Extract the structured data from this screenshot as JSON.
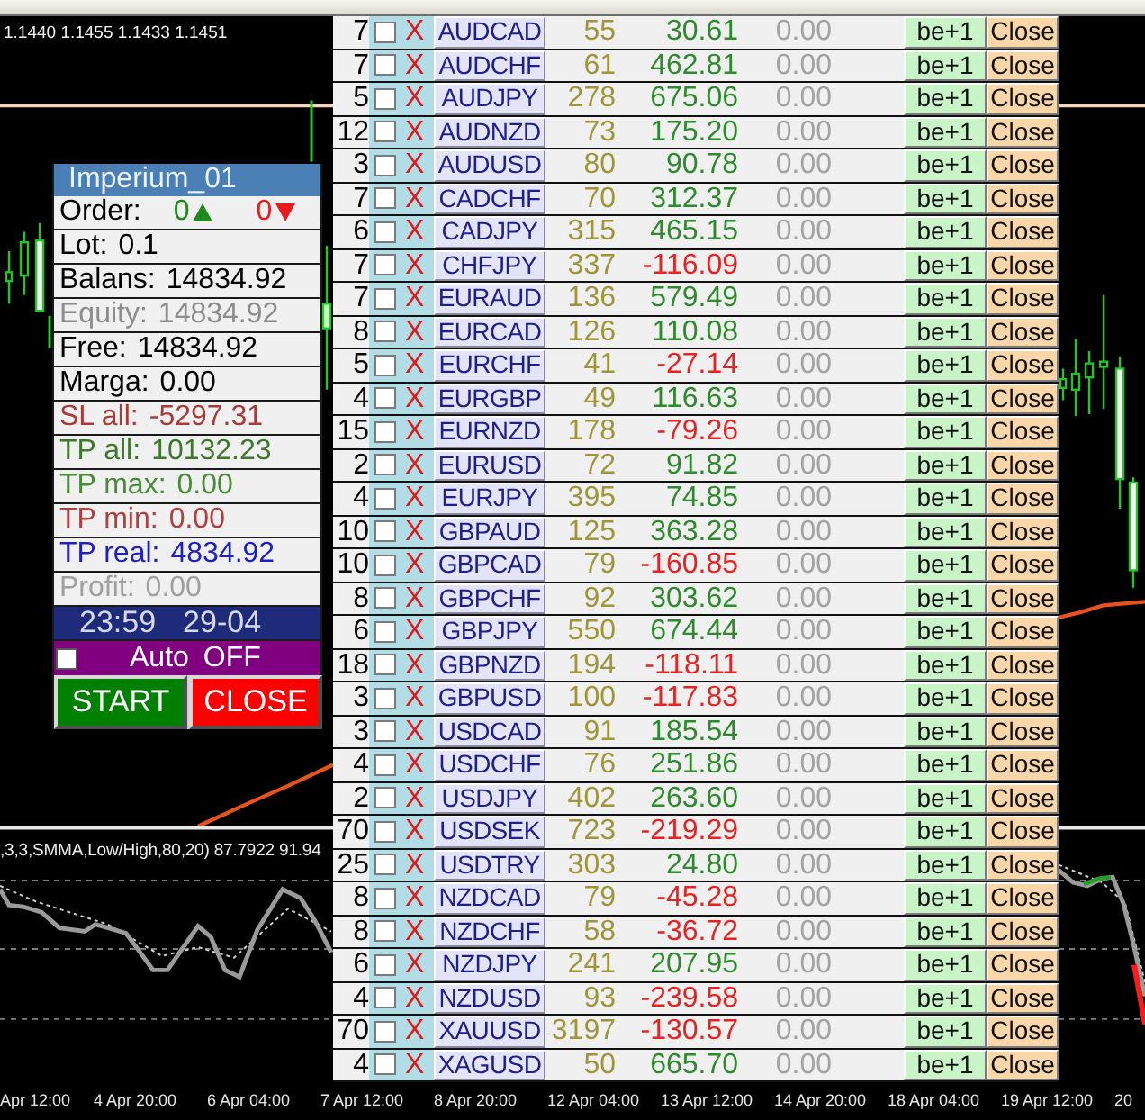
{
  "chart": {
    "price_text": "1.1440 1.1455 1.1433 1.1451",
    "indicator_text": ",3,3,SMMA,Low/High,80,20) 87.7922 91.94",
    "time_axis": [
      "Apr 12:00",
      "4 Apr 20:00",
      "6 Apr 04:00",
      "7 Apr 12:00",
      "8 Apr 20:00",
      "12 Apr 04:00",
      "13 Apr 12:00",
      "14 Apr 20:00",
      "18 Apr 04:00",
      "19 Apr 12:00",
      "20"
    ]
  },
  "panel": {
    "title": "Imperium_01",
    "order": {
      "label": "Order:",
      "buy": "0",
      "sell": "0"
    },
    "stats": [
      {
        "label": "Lot:",
        "value": "0.1",
        "color": "#000000"
      },
      {
        "label": "Balans:",
        "value": "14834.92",
        "color": "#000000"
      },
      {
        "label": "Equity:",
        "value": "14834.92",
        "color": "#8c8c8c"
      },
      {
        "label": "Free:",
        "value": "14834.92",
        "color": "#000000"
      },
      {
        "label": "Marga:",
        "value": "0.00",
        "color": "#000000"
      },
      {
        "label": "SL all:",
        "value": "-5297.31",
        "color": "#a83a3a"
      },
      {
        "label": "TP all:",
        "value": "10132.23",
        "color": "#3a7a2a"
      },
      {
        "label": "TP max:",
        "value": "0.00",
        "color": "#4a8a3a"
      },
      {
        "label": "TP min:",
        "value": "0.00",
        "color": "#b04040"
      },
      {
        "label": "TP real:",
        "value": "4834.92",
        "color": "#2020c0"
      },
      {
        "label": "Profit:",
        "value": "0.00",
        "color": "#a0a0a0"
      }
    ],
    "clock": {
      "time": "23:59",
      "date": "29-04"
    },
    "auto": {
      "label": "Auto",
      "state": "OFF",
      "checked": false
    },
    "buttons": [
      {
        "kind": "start",
        "label": "START"
      },
      {
        "kind": "close",
        "label": "CLOSE"
      }
    ]
  },
  "orders": [
    {
      "count": "7",
      "checked": false,
      "remove": "X",
      "symbol": "AUDCAD",
      "points": "55",
      "profit": "30.61",
      "color": "#2d8a2d",
      "result": "0.00",
      "breakeven": "be+1",
      "close": "Close"
    },
    {
      "count": "7",
      "checked": false,
      "remove": "X",
      "symbol": "AUDCHF",
      "points": "61",
      "profit": "462.81",
      "color": "#2d8a2d",
      "result": "0.00",
      "breakeven": "be+1",
      "close": "Close"
    },
    {
      "count": "5",
      "checked": false,
      "remove": "X",
      "symbol": "AUDJPY",
      "points": "278",
      "profit": "675.06",
      "color": "#2d8a2d",
      "result": "0.00",
      "breakeven": "be+1",
      "close": "Close"
    },
    {
      "count": "12",
      "checked": false,
      "remove": "X",
      "symbol": "AUDNZD",
      "points": "73",
      "profit": "175.20",
      "color": "#2d8a2d",
      "result": "0.00",
      "breakeven": "be+1",
      "close": "Close"
    },
    {
      "count": "3",
      "checked": false,
      "remove": "X",
      "symbol": "AUDUSD",
      "points": "80",
      "profit": "90.78",
      "color": "#2d8a2d",
      "result": "0.00",
      "breakeven": "be+1",
      "close": "Close"
    },
    {
      "count": "7",
      "checked": false,
      "remove": "X",
      "symbol": "CADCHF",
      "points": "70",
      "profit": "312.37",
      "color": "#2d8a2d",
      "result": "0.00",
      "breakeven": "be+1",
      "close": "Close"
    },
    {
      "count": "6",
      "checked": false,
      "remove": "X",
      "symbol": "CADJPY",
      "points": "315",
      "profit": "465.15",
      "color": "#2d8a2d",
      "result": "0.00",
      "breakeven": "be+1",
      "close": "Close"
    },
    {
      "count": "7",
      "checked": false,
      "remove": "X",
      "symbol": "CHFJPY",
      "points": "337",
      "profit": "-116.09",
      "color": "#e62222",
      "result": "0.00",
      "breakeven": "be+1",
      "close": "Close"
    },
    {
      "count": "7",
      "checked": false,
      "remove": "X",
      "symbol": "EURAUD",
      "points": "136",
      "profit": "579.49",
      "color": "#2d8a2d",
      "result": "0.00",
      "breakeven": "be+1",
      "close": "Close"
    },
    {
      "count": "8",
      "checked": false,
      "remove": "X",
      "symbol": "EURCAD",
      "points": "126",
      "profit": "110.08",
      "color": "#2d8a2d",
      "result": "0.00",
      "breakeven": "be+1",
      "close": "Close"
    },
    {
      "count": "5",
      "checked": false,
      "remove": "X",
      "symbol": "EURCHF",
      "points": "41",
      "profit": "-27.14",
      "color": "#e62222",
      "result": "0.00",
      "breakeven": "be+1",
      "close": "Close"
    },
    {
      "count": "4",
      "checked": false,
      "remove": "X",
      "symbol": "EURGBP",
      "points": "49",
      "profit": "116.63",
      "color": "#2d8a2d",
      "result": "0.00",
      "breakeven": "be+1",
      "close": "Close"
    },
    {
      "count": "15",
      "checked": false,
      "remove": "X",
      "symbol": "EURNZD",
      "points": "178",
      "profit": "-79.26",
      "color": "#e62222",
      "result": "0.00",
      "breakeven": "be+1",
      "close": "Close"
    },
    {
      "count": "2",
      "checked": false,
      "remove": "X",
      "symbol": "EURUSD",
      "points": "72",
      "profit": "91.82",
      "color": "#2d8a2d",
      "result": "0.00",
      "breakeven": "be+1",
      "close": "Close"
    },
    {
      "count": "4",
      "checked": false,
      "remove": "X",
      "symbol": "EURJPY",
      "points": "395",
      "profit": "74.85",
      "color": "#2d8a2d",
      "result": "0.00",
      "breakeven": "be+1",
      "close": "Close"
    },
    {
      "count": "10",
      "checked": false,
      "remove": "X",
      "symbol": "GBPAUD",
      "points": "125",
      "profit": "363.28",
      "color": "#2d8a2d",
      "result": "0.00",
      "breakeven": "be+1",
      "close": "Close"
    },
    {
      "count": "10",
      "checked": false,
      "remove": "X",
      "symbol": "GBPCAD",
      "points": "79",
      "profit": "-160.85",
      "color": "#e62222",
      "result": "0.00",
      "breakeven": "be+1",
      "close": "Close"
    },
    {
      "count": "8",
      "checked": false,
      "remove": "X",
      "symbol": "GBPCHF",
      "points": "92",
      "profit": "303.62",
      "color": "#2d8a2d",
      "result": "0.00",
      "breakeven": "be+1",
      "close": "Close"
    },
    {
      "count": "6",
      "checked": false,
      "remove": "X",
      "symbol": "GBPJPY",
      "points": "550",
      "profit": "674.44",
      "color": "#2d8a2d",
      "result": "0.00",
      "breakeven": "be+1",
      "close": "Close"
    },
    {
      "count": "18",
      "checked": false,
      "remove": "X",
      "symbol": "GBPNZD",
      "points": "194",
      "profit": "-118.11",
      "color": "#e62222",
      "result": "0.00",
      "breakeven": "be+1",
      "close": "Close"
    },
    {
      "count": "3",
      "checked": false,
      "remove": "X",
      "symbol": "GBPUSD",
      "points": "100",
      "profit": "-117.83",
      "color": "#e62222",
      "result": "0.00",
      "breakeven": "be+1",
      "close": "Close"
    },
    {
      "count": "3",
      "checked": false,
      "remove": "X",
      "symbol": "USDCAD",
      "points": "91",
      "profit": "185.54",
      "color": "#2d8a2d",
      "result": "0.00",
      "breakeven": "be+1",
      "close": "Close"
    },
    {
      "count": "4",
      "checked": false,
      "remove": "X",
      "symbol": "USDCHF",
      "points": "76",
      "profit": "251.86",
      "color": "#2d8a2d",
      "result": "0.00",
      "breakeven": "be+1",
      "close": "Close"
    },
    {
      "count": "2",
      "checked": false,
      "remove": "X",
      "symbol": "USDJPY",
      "points": "402",
      "profit": "263.60",
      "color": "#2d8a2d",
      "result": "0.00",
      "breakeven": "be+1",
      "close": "Close"
    },
    {
      "count": "70",
      "checked": false,
      "remove": "X",
      "symbol": "USDSEK",
      "points": "723",
      "profit": "-219.29",
      "color": "#e62222",
      "result": "0.00",
      "breakeven": "be+1",
      "close": "Close"
    },
    {
      "count": "25",
      "checked": false,
      "remove": "X",
      "symbol": "USDTRY",
      "points": "303",
      "profit": "24.80",
      "color": "#2d8a2d",
      "result": "0.00",
      "breakeven": "be+1",
      "close": "Close"
    },
    {
      "count": "8",
      "checked": false,
      "remove": "X",
      "symbol": "NZDCAD",
      "points": "79",
      "profit": "-45.28",
      "color": "#e62222",
      "result": "0.00",
      "breakeven": "be+1",
      "close": "Close"
    },
    {
      "count": "8",
      "checked": false,
      "remove": "X",
      "symbol": "NZDCHF",
      "points": "58",
      "profit": "-36.72",
      "color": "#e62222",
      "result": "0.00",
      "breakeven": "be+1",
      "close": "Close"
    },
    {
      "count": "6",
      "checked": false,
      "remove": "X",
      "symbol": "NZDJPY",
      "points": "241",
      "profit": "207.95",
      "color": "#2d8a2d",
      "result": "0.00",
      "breakeven": "be+1",
      "close": "Close"
    },
    {
      "count": "4",
      "checked": false,
      "remove": "X",
      "symbol": "NZDUSD",
      "points": "93",
      "profit": "-239.58",
      "color": "#e62222",
      "result": "0.00",
      "breakeven": "be+1",
      "close": "Close"
    },
    {
      "count": "70",
      "checked": false,
      "remove": "X",
      "symbol": "XAUUSD",
      "points": "3197",
      "profit": "-130.57",
      "color": "#e62222",
      "result": "0.00",
      "breakeven": "be+1",
      "close": "Close"
    },
    {
      "count": "4",
      "checked": false,
      "remove": "X",
      "symbol": "XAGUSD",
      "points": "50",
      "profit": "665.70",
      "color": "#2d8a2d",
      "result": "0.00",
      "breakeven": "be+1",
      "close": "Close"
    }
  ]
}
